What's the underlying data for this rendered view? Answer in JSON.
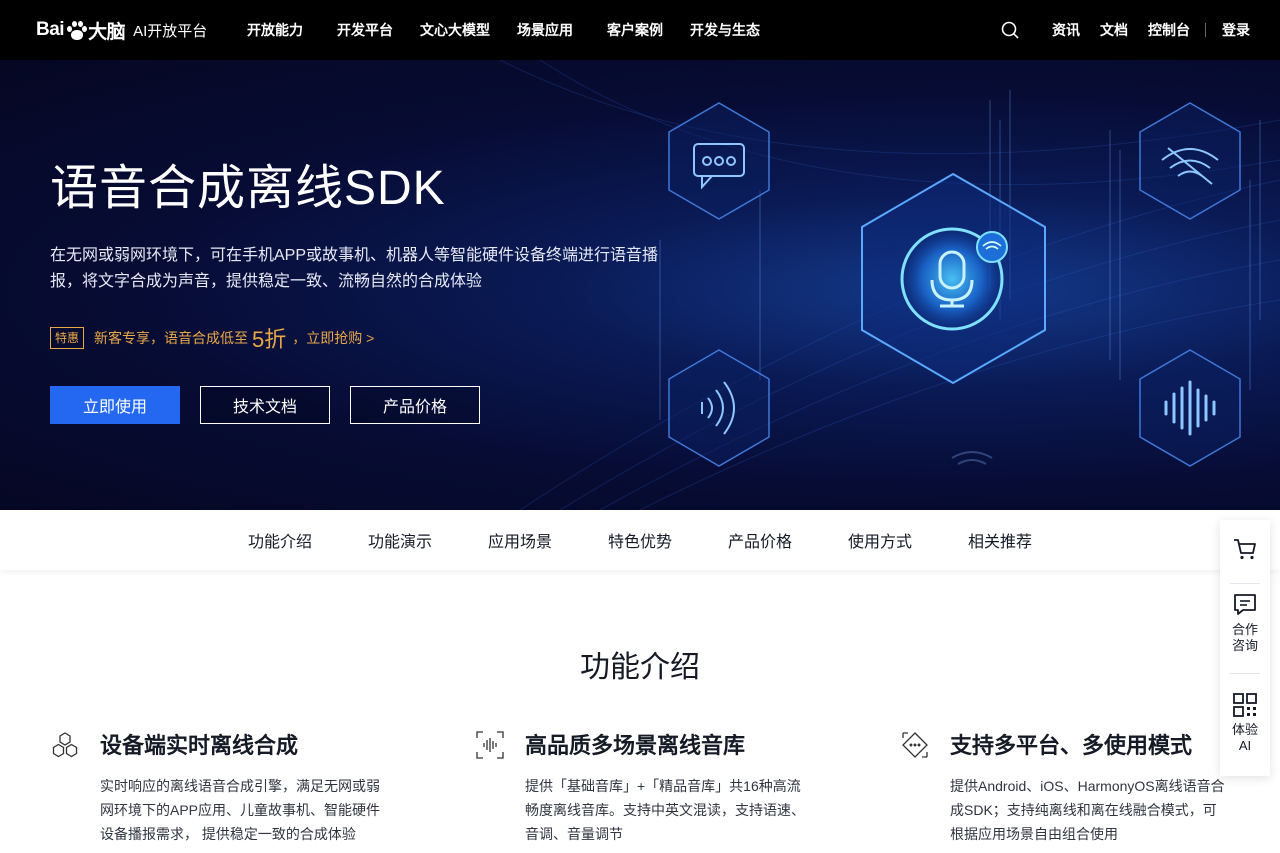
{
  "topnav": {
    "logo_mark": "Bai",
    "logo_mark_tail": "大脑",
    "logo_text": "AI开放平台",
    "items": [
      "开放能力",
      "开发平台",
      "文心大模型",
      "场景应用",
      "客户案例",
      "开发与生态"
    ],
    "right_items": [
      "资讯",
      "文档",
      "控制台"
    ],
    "login": "登录"
  },
  "hero": {
    "title": "语音合成离线SDK",
    "description": "在无网或弱网环境下，可在手机APP或故事机、机器人等智能硬件设备终端进行语音播报，将文字合成为声音，提供稳定一致、流畅自然的合成体验",
    "promo": {
      "badge": "特惠",
      "text": "新客专享，语音合成低至",
      "highlight": "5折",
      "link": "，立即抢购 >"
    },
    "buttons": {
      "primary": "立即使用",
      "docs": "技术文档",
      "price": "产品价格"
    }
  },
  "subnav": {
    "tabs": [
      "功能介绍",
      "功能演示",
      "应用场景",
      "特色优势",
      "产品价格",
      "使用方式",
      "相关推荐"
    ]
  },
  "section": {
    "title": "功能介绍",
    "features": [
      {
        "title": "设备端实时离线合成",
        "desc": "实时响应的离线语音合成引擎，满足无网或弱网环境下的APP应用、儿童故事机、智能硬件设备播报需求， 提供稳定一致的合成体验",
        "icon": "hexagon-cluster-icon"
      },
      {
        "title": "高品质多场景离线音库",
        "desc": "提供「基础音库」+「精品音库」共16种高流畅度离线音库。支持中英文混读，支持语速、音调、音量调节",
        "icon": "soundwave-frame-icon"
      },
      {
        "title": "支持多平台、多使用模式",
        "desc": "提供Android、iOS、HarmonyOS离线语音合成SDK；支持纯离线和离在线融合模式，可根据应用场景自由组合使用",
        "icon": "diamond-dots-icon"
      }
    ]
  },
  "sidebar": {
    "consult": "合作咨询",
    "try_ai": "体验AI"
  },
  "colors": {
    "primary": "#2468f2",
    "promo": "#e8a846",
    "nav_bg": "#000000"
  }
}
